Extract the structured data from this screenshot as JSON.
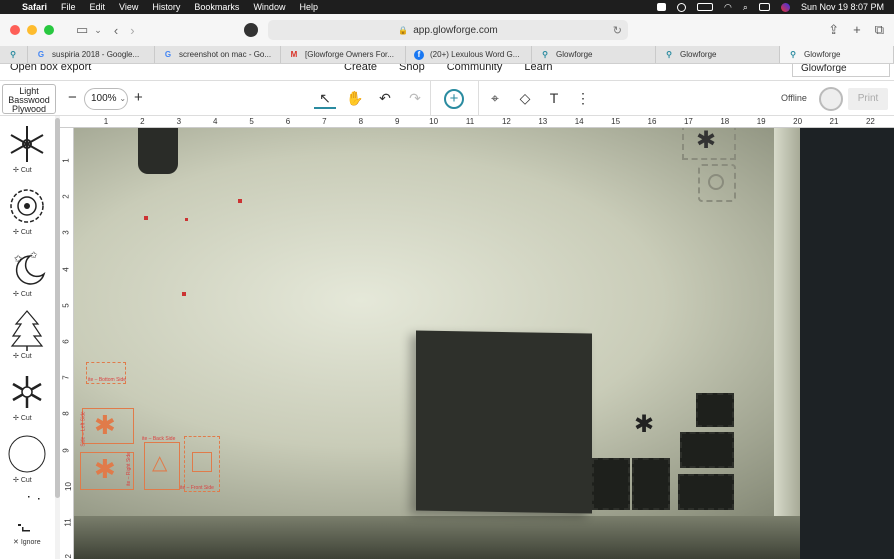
{
  "menubar": {
    "app": "Safari",
    "items": [
      "File",
      "Edit",
      "View",
      "History",
      "Bookmarks",
      "Window",
      "Help"
    ],
    "datetime": "Sun Nov 19  8:07 PM"
  },
  "browser": {
    "url": "app.glowforge.com",
    "tabs": [
      {
        "label": "suspiria 2018 - Google...",
        "favicon": "G",
        "color": "#4285f4"
      },
      {
        "label": "screenshot on mac - Go...",
        "favicon": "G",
        "color": "#4285f4"
      },
      {
        "label": "[Glowforge Owners For...",
        "favicon": "M",
        "color": "#d93025"
      },
      {
        "label": "(20+) Lexulous Word G...",
        "favicon": "f",
        "color": "#1877f2"
      },
      {
        "label": "Glowforge",
        "favicon": "gf",
        "color": "#2a8ba0"
      },
      {
        "label": "Glowforge",
        "favicon": "gf",
        "color": "#2a8ba0"
      },
      {
        "label": "Glowforge",
        "favicon": "gf",
        "color": "#2a8ba0"
      }
    ]
  },
  "app_header": {
    "breadcrumb": "Open box export",
    "nav": [
      "Create",
      "Shop",
      "Community",
      "Learn"
    ],
    "brand": "Glowforge"
  },
  "toolbar": {
    "material": "Light Basswood Plywood",
    "zoom": "100%",
    "zoom_minus": "−",
    "zoom_plus": "+",
    "status": "Offline",
    "print": "Print"
  },
  "designs": [
    {
      "icon": "snowflake-icon",
      "action": "Cut"
    },
    {
      "icon": "snowflake-ornament-icon",
      "action": "Cut"
    },
    {
      "icon": "moon-stars-icon",
      "action": "Cut"
    },
    {
      "icon": "tree-icon",
      "action": "Cut"
    },
    {
      "icon": "snowflake-icon",
      "action": "Cut"
    },
    {
      "icon": "circle-icon",
      "action": "Cut"
    },
    {
      "icon": "dots-icon",
      "action": "Ignore"
    }
  ],
  "ruler_top": [
    "1",
    "2",
    "3",
    "4",
    "5",
    "6",
    "7",
    "8",
    "9",
    "10",
    "11",
    "12",
    "13",
    "14",
    "15",
    "16",
    "17",
    "18",
    "19",
    "20",
    "21",
    "22"
  ],
  "ruler_left": [
    "1",
    "2",
    "3",
    "4",
    "5",
    "6",
    "7",
    "8",
    "9",
    "10",
    "11",
    "12"
  ],
  "bed_labels": [
    {
      "text": "ite – Bottom Side"
    },
    {
      "text": "Side – Left Side"
    },
    {
      "text": "ite – Right Side"
    },
    {
      "text": "ite – Back Side"
    },
    {
      "text": "ite – Front Side"
    }
  ],
  "colors": {
    "accent": "#2a8ba0",
    "cut_outline": "#e07b4a",
    "label_red": "#d94040"
  }
}
